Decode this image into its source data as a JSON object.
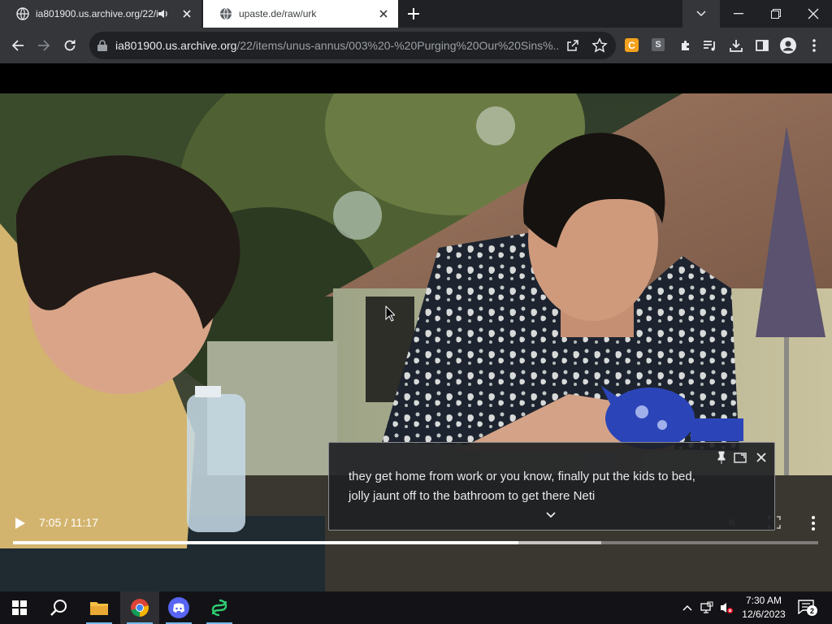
{
  "browser": {
    "tabs": [
      {
        "title": "ia801900.us.archive.org/22/i",
        "active": true,
        "audio": true
      },
      {
        "title": "upaste.de/raw/urk",
        "active": false,
        "audio": false
      }
    ],
    "omnibox": {
      "host": "ia801900.us.archive.org",
      "path": "/22/items/unus-annus/003%20-%20Purging%20Our%20Sins%..."
    },
    "extensions": {
      "c_badge": "C",
      "s_badge": "S"
    },
    "accent": "#35363a"
  },
  "video": {
    "current_time": "7:05",
    "duration": "11:17",
    "time_display": "7:05 / 11:17",
    "progress_fraction": 0.628,
    "buffered_fraction": 0.731,
    "scene_icons": [
      "play-icon",
      "more-vert-icon"
    ]
  },
  "caption": {
    "lines": [
      "they get home from work or you know, finally put the kids to bed,",
      "jolly jaunt off to the bathroom to get there Neti"
    ]
  },
  "taskbar": {
    "apps": [
      "start-icon",
      "search-icon",
      "file-explorer-icon",
      "chrome-icon",
      "discord-icon",
      "app-icon"
    ],
    "time": "7:30 AM",
    "date": "12/6/2023",
    "notification_count": "2"
  }
}
